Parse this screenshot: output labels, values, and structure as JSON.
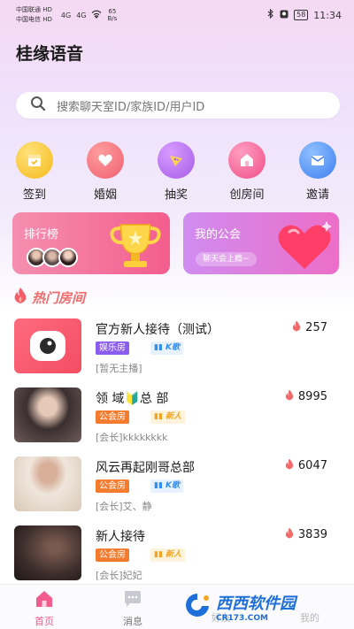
{
  "status_bar": {
    "carrier1": "中国联通",
    "carrier1_badge": "HD",
    "carrier2": "中国电信",
    "carrier2_badge": "HD",
    "network1": "4G",
    "network2": "4G",
    "speed_value": "65",
    "speed_unit": "B/s",
    "battery": "58",
    "time": "11:34"
  },
  "app_title": "桂缘语音",
  "search": {
    "placeholder": "搜索聊天室ID/家族ID/用户ID"
  },
  "quick_actions": [
    {
      "label": "签到",
      "icon": "calendar-icon",
      "color": "#f7c32e"
    },
    {
      "label": "婚姻",
      "icon": "heart-icon",
      "color": "#f2737d"
    },
    {
      "label": "抽奖",
      "icon": "gift-icon",
      "color": "#b46ae8"
    },
    {
      "label": "创房间",
      "icon": "house-icon",
      "color": "#f45d8e"
    },
    {
      "label": "邀请",
      "icon": "envelope-icon",
      "color": "#4c8ef5"
    }
  ],
  "cards": {
    "ranking": {
      "title": "排行榜"
    },
    "guild": {
      "title": "我的公会",
      "subtitle": "聊天会上瘾~"
    }
  },
  "hot_section": {
    "title": "热门房间"
  },
  "rooms": [
    {
      "name": "官方新人接待（测试）",
      "type": "娱乐房",
      "sub_tag": "K歌",
      "host": "[暂无主播]",
      "heat": "257"
    },
    {
      "name": "领 域🔰总 部",
      "type": "公会房",
      "sub_tag": "新人",
      "host": "[会长]kkkkkkkk",
      "heat": "8995"
    },
    {
      "name": "风云再起刚哥总部",
      "type": "公会房",
      "sub_tag": "K歌",
      "host": "[会长]艾、静",
      "heat": "6047"
    },
    {
      "name": "新人接待",
      "type": "公会房",
      "sub_tag": "新人",
      "host": "[会长]妃妃",
      "heat": "3839"
    }
  ],
  "bottom_nav": {
    "home": "首页",
    "messages": "消息",
    "friends": "好友",
    "mine": "我的"
  },
  "watermark": {
    "text": "西西软件园",
    "sub": "CR173.COM"
  },
  "colors": {
    "accent": "#f35d8d",
    "heat": "#f36a6a",
    "type_tag_ent_bg": "#8a5cf0",
    "type_tag_guild_bg": "#f57c2e",
    "ktv_tag": "#2f8ff0",
    "new_tag": "#f2a421"
  }
}
